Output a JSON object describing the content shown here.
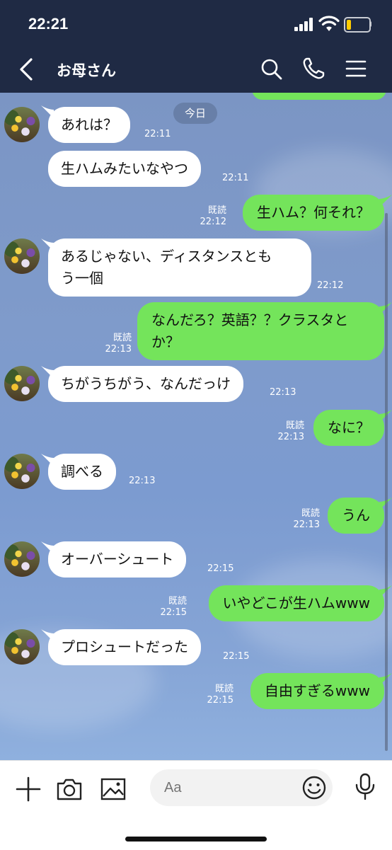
{
  "status": {
    "time": "22:21"
  },
  "header": {
    "contact_name": "お母さん"
  },
  "chat": {
    "date_label": "今日",
    "read_label": "既読",
    "messages": [
      {
        "dir": "in",
        "text": "あれは？",
        "time": "22:11"
      },
      {
        "dir": "in",
        "text": "生ハムみたいなやつ",
        "time": "22:11"
      },
      {
        "dir": "out",
        "text": "生ハム？何それ？",
        "time": "22:12",
        "read": "既読"
      },
      {
        "dir": "in",
        "text": "あるじゃない、ディスタンスとも\nう一個",
        "time": "22:12"
      },
      {
        "dir": "out",
        "text": "なんだろ？英語？？クラスタと\nか？",
        "time": "22:13",
        "read": "既読"
      },
      {
        "dir": "in",
        "text": "ちがうちがう、なんだっけ",
        "time": "22:13"
      },
      {
        "dir": "out",
        "text": "なに？",
        "time": "22:13",
        "read": "既読"
      },
      {
        "dir": "in",
        "text": "調べる",
        "time": "22:13"
      },
      {
        "dir": "out",
        "text": "うん",
        "time": "22:13",
        "read": "既読"
      },
      {
        "dir": "in",
        "text": "オーバーシュート",
        "time": "22:15"
      },
      {
        "dir": "out",
        "text": "いやどこが生ハムwww",
        "time": "22:15",
        "read": "既読"
      },
      {
        "dir": "in",
        "text": "プロシュートだった",
        "time": "22:15"
      },
      {
        "dir": "out",
        "text": "自由すぎるwww",
        "time": "22:15",
        "read": "既読"
      }
    ]
  },
  "input": {
    "placeholder": "Aa"
  },
  "icons": {
    "back": "chevron-left-icon",
    "search": "search-icon",
    "call": "phone-icon",
    "menu": "menu-icon",
    "plus": "plus-icon",
    "camera": "camera-icon",
    "image": "image-icon",
    "emoji": "emoji-icon",
    "mic": "mic-icon"
  },
  "colors": {
    "header": "#1f2a44",
    "outgoing_bubble": "#74e45b",
    "incoming_bubble": "#ffffff",
    "battery": "#ffcc00"
  }
}
